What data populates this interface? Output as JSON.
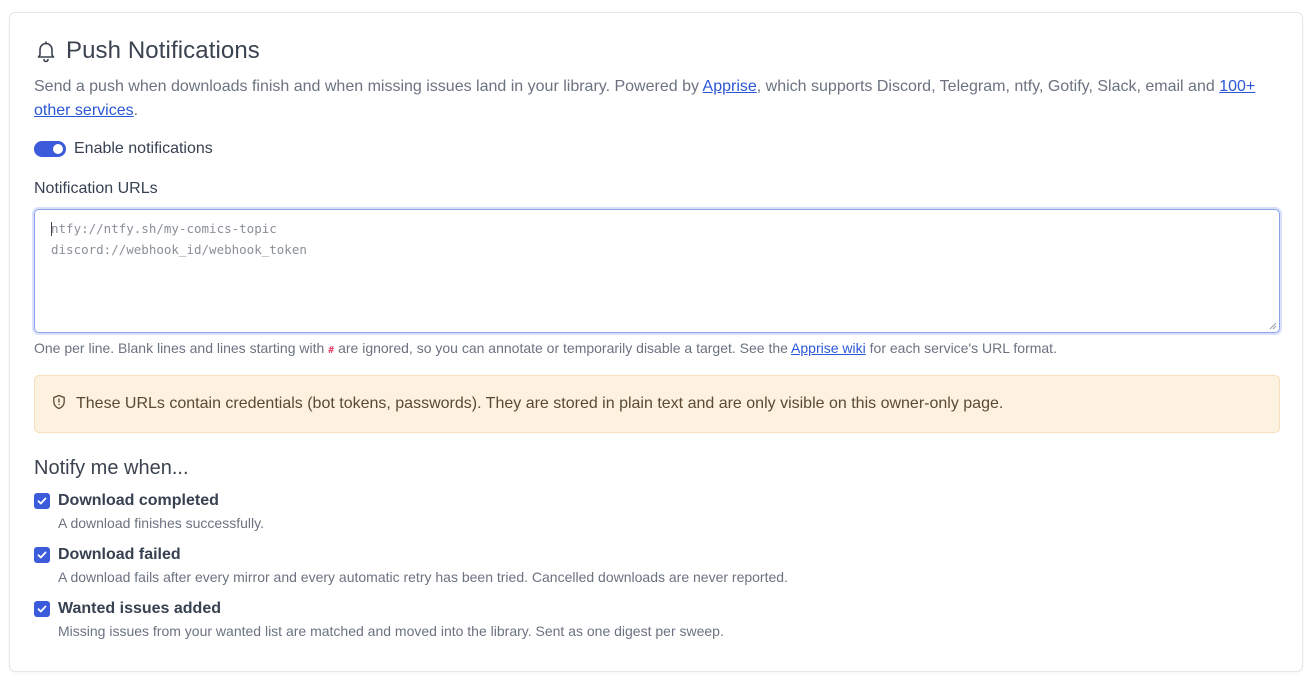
{
  "section": {
    "icon": "bell-icon",
    "title": "Push Notifications",
    "description": {
      "text_1": "Send a push when downloads finish and when missing issues land in your library. Powered by ",
      "link_apprise": "Apprise",
      "text_2": ", which supports Discord, Telegram, ntfy, Gotify, Slack, email and ",
      "link_services": "100+ other services",
      "text_3": "."
    }
  },
  "toggle": {
    "label": "Enable notifications",
    "enabled": true
  },
  "urls_field": {
    "label": "Notification URLs",
    "placeholder": "ntfy://ntfy.sh/my-comics-topic\ndiscord://webhook_id/webhook_token",
    "value": "",
    "hint": {
      "text_1": "One per line. Blank lines and lines starting with ",
      "code": "#",
      "text_2": " are ignored, so you can annotate or temporarily disable a target. See the ",
      "link": "Apprise wiki",
      "text_3": " for each service's URL format."
    }
  },
  "alert": {
    "icon": "shield-icon",
    "text": "These URLs contain credentials (bot tokens, passwords). They are stored in plain text and are only visible on this owner-only page."
  },
  "notify": {
    "heading": "Notify me when...",
    "options": [
      {
        "label": "Download completed",
        "description": "A download finishes successfully.",
        "checked": true
      },
      {
        "label": "Download failed",
        "description": "A download fails after every mirror and every automatic retry has been tried. Cancelled downloads are never reported.",
        "checked": true
      },
      {
        "label": "Wanted issues added",
        "description": "Missing issues from your wanted list are matched and moved into the library. Sent as one digest per sweep.",
        "checked": true
      }
    ]
  },
  "colors": {
    "accent": "#3b5bdb",
    "link": "#2b57d6",
    "alert_bg": "#fdf1df",
    "alert_border": "#f5dfbe"
  }
}
